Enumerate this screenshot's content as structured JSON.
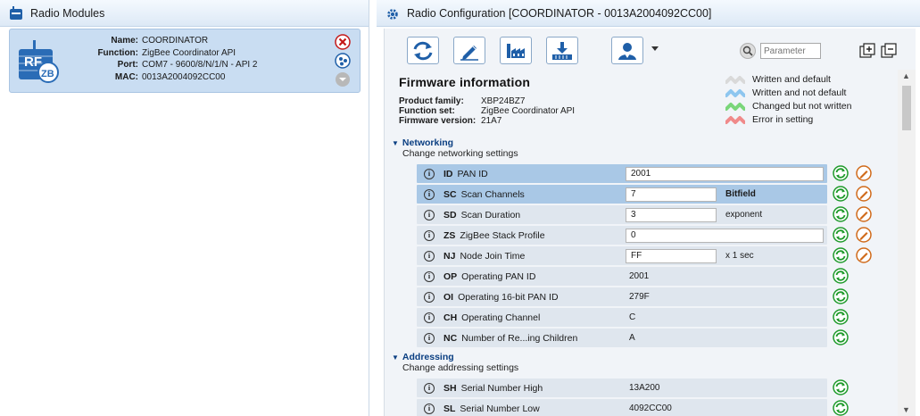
{
  "left_panel": {
    "title": "Radio Modules",
    "module": {
      "logo_text_top": "RF",
      "logo_text_bottom": "ZB",
      "name_key": "Name:",
      "name": "COORDINATOR",
      "function_key": "Function:",
      "function": "ZigBee Coordinator API",
      "port_key": "Port:",
      "port": "COM7 - 9600/8/N/1/N - API 2",
      "mac_key": "MAC:",
      "mac": "0013A2004092CC00"
    }
  },
  "right_panel": {
    "title": "Radio Configuration [COORDINATOR - 0013A2004092CC00]",
    "toolbar": {
      "buttons": [
        "read-icon",
        "write-icon",
        "default-icon",
        "update-icon",
        "profile-icon"
      ],
      "search_placeholder": "Parameter"
    },
    "firmware": {
      "title": "Firmware information",
      "product_family_key": "Product family:",
      "product_family": "XBP24BZ7",
      "function_set_key": "Function set:",
      "function_set": "ZigBee Coordinator API",
      "firmware_version_key": "Firmware version:",
      "firmware_version": "21A7"
    },
    "legend": [
      {
        "label": "Written and default",
        "color": "#d9d9d9"
      },
      {
        "label": "Written and not default",
        "color": "#8ec6ef"
      },
      {
        "label": "Changed but not written",
        "color": "#7ad67a"
      },
      {
        "label": "Error in setting",
        "color": "#f08a8a"
      }
    ],
    "sections": {
      "networking": {
        "title": "Networking",
        "subtitle": "Change networking settings",
        "params": [
          {
            "code": "ID",
            "name": "PAN ID",
            "value": "2001",
            "unit": "",
            "editable": true,
            "wide": true
          },
          {
            "code": "SC",
            "name": "Scan Channels",
            "value": "7",
            "unit": "Bitfield",
            "editable": true,
            "wide": false
          },
          {
            "code": "SD",
            "name": "Scan Duration",
            "value": "3",
            "unit": "exponent",
            "editable": true,
            "wide": false
          },
          {
            "code": "ZS",
            "name": "ZigBee Stack Profile",
            "value": "0",
            "unit": "",
            "editable": true,
            "wide": true
          },
          {
            "code": "NJ",
            "name": "Node Join Time",
            "value": "FF",
            "unit": "x 1 sec",
            "editable": true,
            "wide": false
          },
          {
            "code": "OP",
            "name": "Operating PAN ID",
            "value": "2001",
            "unit": "",
            "editable": false
          },
          {
            "code": "OI",
            "name": "Operating 16-bit PAN ID",
            "value": "279F",
            "unit": "",
            "editable": false
          },
          {
            "code": "CH",
            "name": "Operating Channel",
            "value": "C",
            "unit": "",
            "editable": false
          },
          {
            "code": "NC",
            "name": "Number of Re...ing Children",
            "value": "A",
            "unit": "",
            "editable": false
          }
        ]
      },
      "addressing": {
        "title": "Addressing",
        "subtitle": "Change addressing settings",
        "params": [
          {
            "code": "SH",
            "name": "Serial Number High",
            "value": "13A200",
            "unit": "",
            "editable": false
          },
          {
            "code": "SL",
            "name": "Serial Number Low",
            "value": "4092CC00",
            "unit": "",
            "editable": false
          }
        ]
      }
    }
  }
}
